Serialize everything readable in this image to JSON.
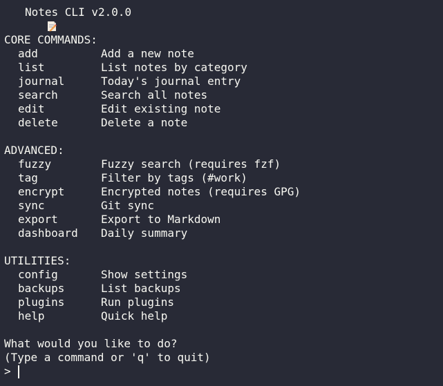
{
  "title": {
    "icon": "memo-icon",
    "text": "Notes CLI v2.0.0"
  },
  "sections": [
    {
      "header": "CORE COMMANDS:",
      "commands": [
        {
          "name": "add",
          "desc": "Add a new note"
        },
        {
          "name": "list",
          "desc": "List notes by category"
        },
        {
          "name": "journal",
          "desc": "Today's journal entry"
        },
        {
          "name": "search",
          "desc": "Search all notes"
        },
        {
          "name": "edit",
          "desc": "Edit existing note"
        },
        {
          "name": "delete",
          "desc": "Delete a note"
        }
      ]
    },
    {
      "header": "ADVANCED:",
      "commands": [
        {
          "name": "fuzzy",
          "desc": "Fuzzy search (requires fzf)"
        },
        {
          "name": "tag",
          "desc": "Filter by tags (#work)"
        },
        {
          "name": "encrypt",
          "desc": "Encrypted notes (requires GPG)"
        },
        {
          "name": "sync",
          "desc": "Git sync"
        },
        {
          "name": "export",
          "desc": "Export to Markdown"
        },
        {
          "name": "dashboard",
          "desc": "Daily summary"
        }
      ]
    },
    {
      "header": "UTILITIES:",
      "commands": [
        {
          "name": "config",
          "desc": "Show settings"
        },
        {
          "name": "backups",
          "desc": "List backups"
        },
        {
          "name": "plugins",
          "desc": "Run plugins"
        },
        {
          "name": "help",
          "desc": "Quick help"
        }
      ]
    }
  ],
  "question": "What would you like to do?",
  "hint": "(Type a command or 'q' to quit)",
  "prompt": ">",
  "colors": {
    "background": "#282a36",
    "foreground": "#f8f8f2",
    "icon_paper": "#f4ede2",
    "icon_pencil": "#f0a050"
  }
}
